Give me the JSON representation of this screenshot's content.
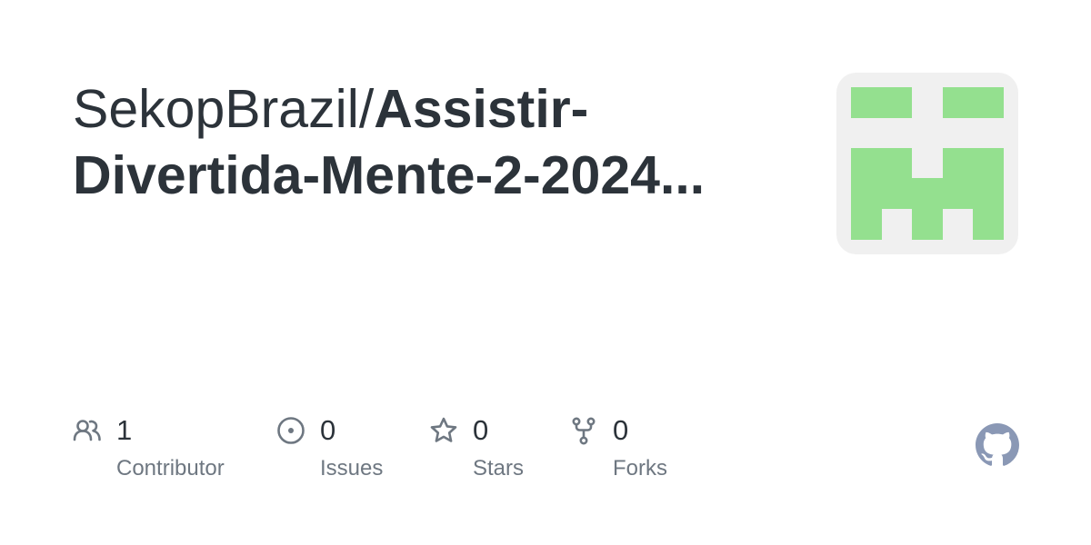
{
  "repo": {
    "owner": "SekopBrazil",
    "slash": "/",
    "name_line1": "Assistir-",
    "name_line2": "Divertida-Mente-2-2024..."
  },
  "identicon": {
    "foreground": "#94e08f",
    "background": "#f0f0f0"
  },
  "stats": {
    "contributors": {
      "count": "1",
      "label": "Contributor",
      "icon": "people-icon"
    },
    "issues": {
      "count": "0",
      "label": "Issues",
      "icon": "issue-opened-icon"
    },
    "stars": {
      "count": "0",
      "label": "Stars",
      "icon": "star-icon"
    },
    "forks": {
      "count": "0",
      "label": "Forks",
      "icon": "repo-forked-icon"
    }
  },
  "colors": {
    "title": "#2c333a",
    "muted": "#6e7781",
    "github_logo": "#8a98b5"
  }
}
